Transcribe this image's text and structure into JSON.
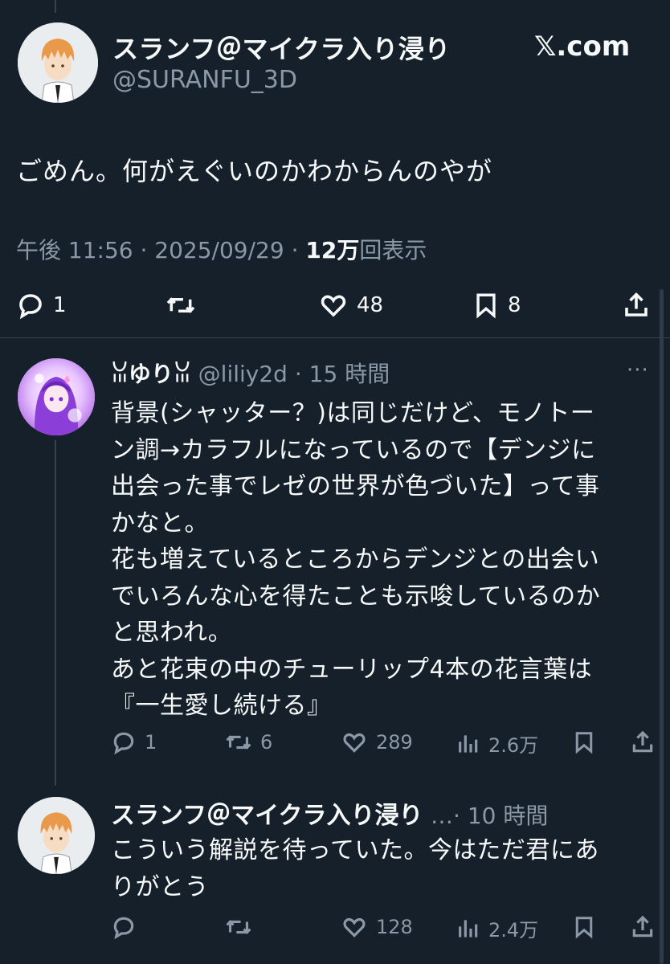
{
  "main_tweet": {
    "display_name": "スランフ＠マイクラ入り浸り",
    "handle": "@SURANFU_3D",
    "brand": "𝕏.com",
    "text": "ごめん。何がえぐいのかわからんのやが",
    "time": "午後 11:56 · 2025/09/29 · ",
    "views_count": "12万",
    "views_label": "回表示",
    "actions": {
      "reply_icon": "reply-icon",
      "replies": "1",
      "retweet_icon": "retweet-icon",
      "retweets": "",
      "like_icon": "heart-icon",
      "likes": "48",
      "bookmark_icon": "bookmark-icon",
      "bookmarks": "8",
      "share_icon": "share-icon"
    }
  },
  "reply_1": {
    "display_name": "ꈍゆりꈍ",
    "handle": "@liliy2d",
    "time": "· 15 時間",
    "more": "···",
    "lines": [
      "背景(シャッター？)は同じだけど、モノトー",
      "ン調→カラフルになっているので【デンジに",
      "出会った事でレゼの世界が色づいた】って事",
      "かなと。",
      "花も増えているところからデンジとの出会い",
      "でいろんな心を得たことも示唆しているのか",
      "と思われ。",
      "あと花束の中のチューリップ4本の花言葉は",
      "『一生愛し続ける』"
    ],
    "actions": {
      "replies": "1",
      "retweets": "6",
      "likes": "289",
      "views": "2.6万"
    }
  },
  "reply_2": {
    "display_name": "スランフ＠マイクラ入り浸り",
    "ellipsis": "…",
    "time": "· 10 時間",
    "lines": [
      "こういう解説を待っていた。今はただ君にあ",
      "りがとう"
    ],
    "actions": {
      "replies": "",
      "retweets": "",
      "likes": "128",
      "views": "2.4万"
    }
  },
  "colors": {
    "background": "#15202b",
    "text": "#f7f9f9",
    "secondary": "#8b98a5",
    "divider": "#38444d"
  }
}
